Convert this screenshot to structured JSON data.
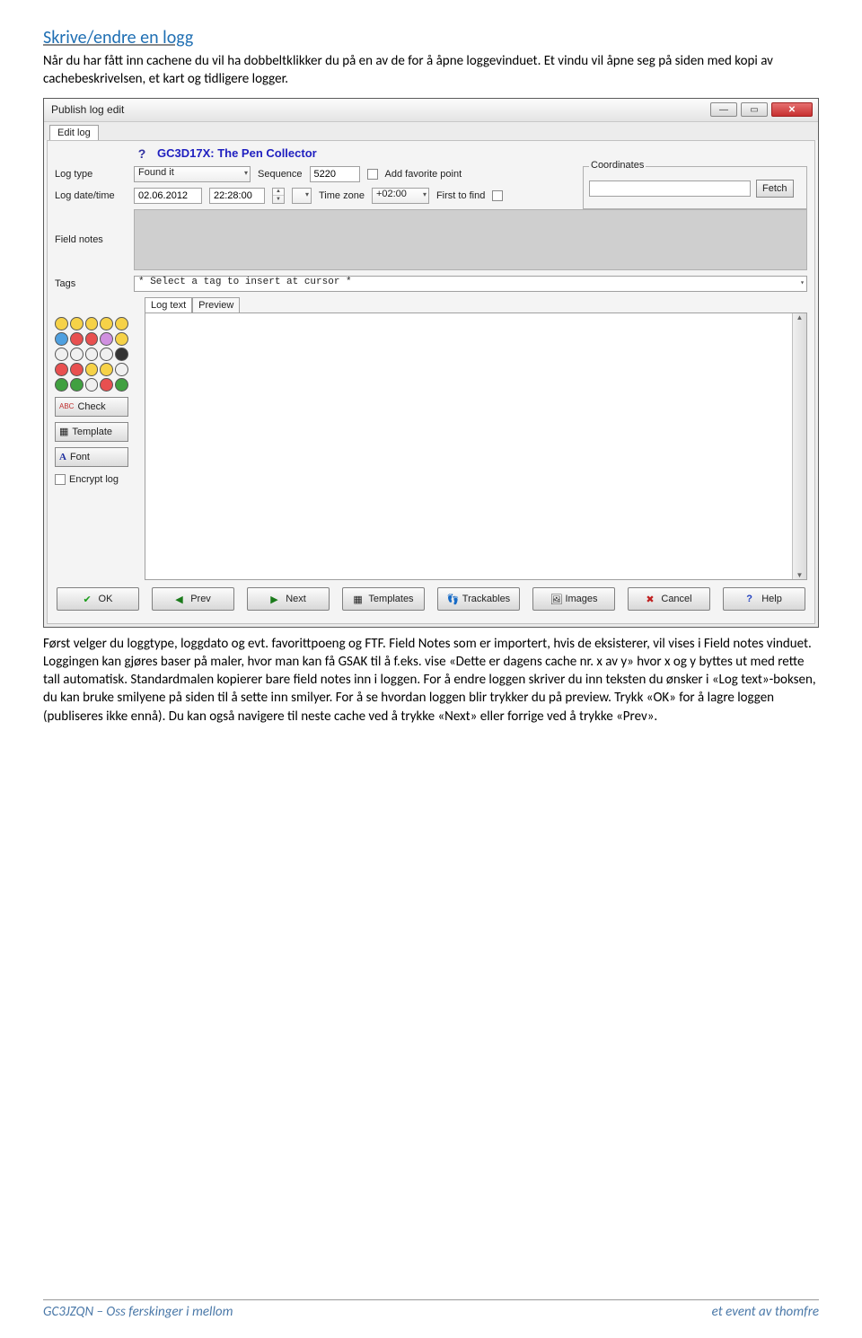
{
  "heading": "Skrive/endre en logg",
  "intro": "Når du har fått inn cachene du vil ha dobbeltklikker du på en av de for å åpne loggevinduet. Et vindu vil åpne seg på siden med kopi av cachebeskrivelsen, et kart og tidligere logger.",
  "window": {
    "title": "Publish log edit",
    "tab": "Edit log",
    "cacheTitle": "GC3D17X: The Pen Collector",
    "labels": {
      "logtype": "Log type",
      "logdate": "Log date/time",
      "fieldnotes": "Field notes",
      "tags": "Tags",
      "sequence": "Sequence",
      "timezone": "Time zone",
      "addfav": "Add favorite point",
      "firsttofind": "First to find",
      "coords": "Coordinates",
      "fetch": "Fetch",
      "logtext": "Log text",
      "preview": "Preview",
      "check": "Check",
      "template": "Template",
      "font": "Font",
      "encrypt": "Encrypt log"
    },
    "values": {
      "logtype": "Found it",
      "sequence": "5220",
      "date": "02.06.2012",
      "time": "22:28:00",
      "timezone": "+02:00",
      "tagsPlaceholder": "* Select a tag to insert at cursor *"
    },
    "buttons": {
      "ok": "OK",
      "prev": "Prev",
      "next": "Next",
      "templates": "Templates",
      "trackables": "Trackables",
      "images": "Images",
      "cancel": "Cancel",
      "help": "Help"
    }
  },
  "after": " Først velger du loggtype, loggdato og evt. favorittpoeng og FTF. Field Notes som er importert, hvis de eksisterer, vil vises i Field notes vinduet. Loggingen kan gjøres baser på maler, hvor man kan få GSAK til å f.eks. vise «Dette er dagens cache nr. x av y» hvor x og y byttes ut med rette tall automatisk. Standardmalen kopierer bare field notes inn i loggen. For å endre loggen skriver du inn teksten du ønsker i «Log text»-boksen, du kan bruke smilyene på siden til å sette inn smilyer. For å se hvordan loggen blir trykker du på preview. Trykk «OK» for å lagre loggen (publiseres ikke ennå). Du kan også navigere til neste cache ved å trykke «Next» eller forrige ved å trykke «Prev».",
  "footer": {
    "left": "GC3JZQN – Oss ferskinger i mellom",
    "right": "et event av thomfre"
  },
  "emojiColors": [
    [
      "#f6d248",
      "#f6d248",
      "#f6d248",
      "#f6d248",
      "#f6d248"
    ],
    [
      "#4fa0e0",
      "#e85050",
      "#e85050",
      "#d090e0",
      "#f6d248"
    ],
    [
      "#f0f0f0",
      "#f0f0f0",
      "#f0f0f0",
      "#f0f0f0",
      "#333333"
    ],
    [
      "#e85050",
      "#e85050",
      "#f6d248",
      "#f6d248",
      "#f0f0f0"
    ],
    [
      "#40a040",
      "#40a040",
      "#f0f0f0",
      "#e85050",
      "#40a040"
    ]
  ]
}
